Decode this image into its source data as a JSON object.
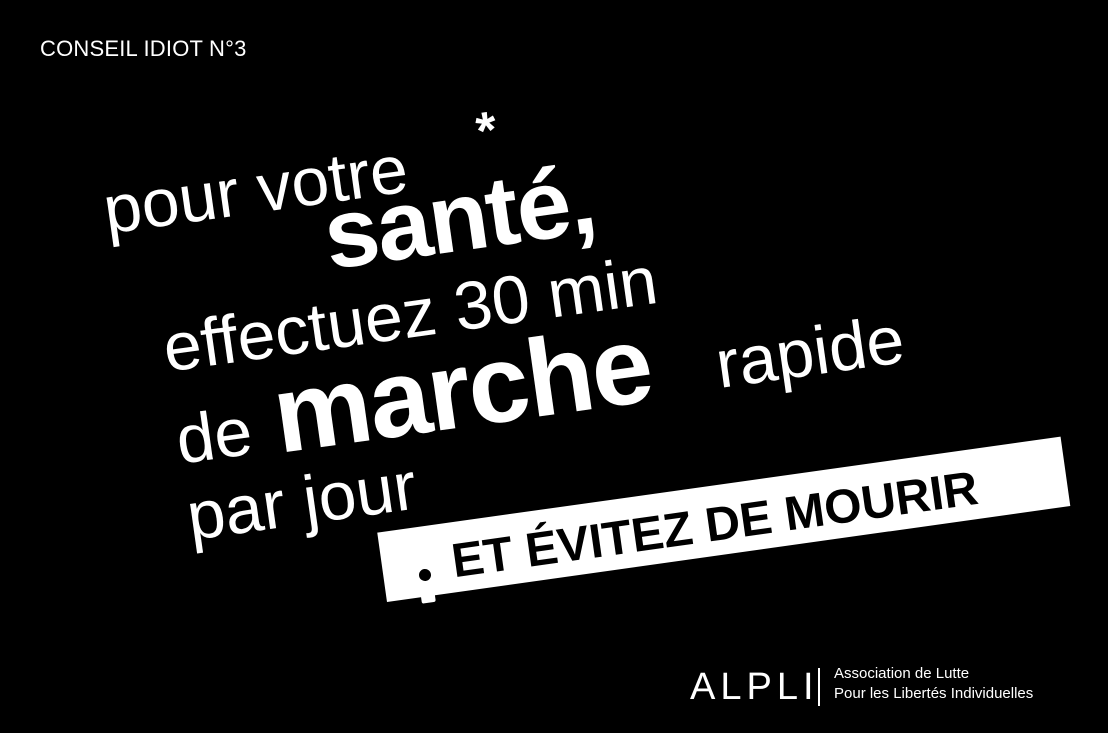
{
  "top_label": "CONSEIL IDIOT N°3",
  "slogan": {
    "line1": "pour votre",
    "asterisk": "*",
    "line2": "santé,",
    "line3": "effectuez 30 min",
    "line4_prefix": "de",
    "line4_bold": "marche",
    "line4_suffix": "rapide",
    "line5": "par jour"
  },
  "banner": {
    "asterisk_icon": "asterisk-icon",
    "text": "ET ÉVITEZ DE MOURIR"
  },
  "footer": {
    "logo": "ALPLI",
    "assoc_line1": "Association de Lutte",
    "assoc_line2": "Pour les Libertés Individuelles"
  },
  "colors": {
    "background": "#000000",
    "text": "#ffffff",
    "banner_bg": "#ffffff",
    "banner_text": "#000000"
  }
}
